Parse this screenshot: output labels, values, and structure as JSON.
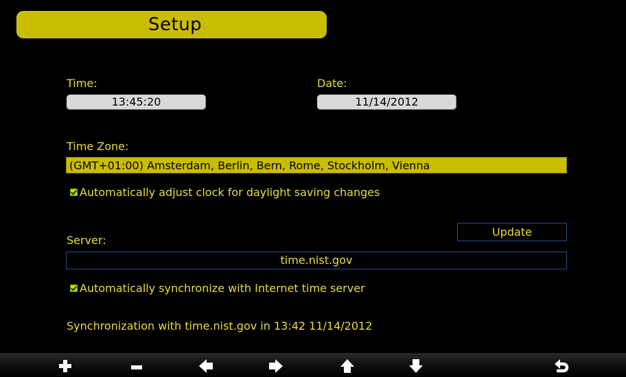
{
  "header": {
    "title": "Setup"
  },
  "time": {
    "label": "Time:",
    "value": "13:45:20"
  },
  "date": {
    "label": "Date:",
    "value": "11/14/2012"
  },
  "timezone": {
    "label": "Time Zone:",
    "value": "(GMT+01:00) Amsterdam, Berlin, Bern, Rome, Stockholm, Vienna"
  },
  "dst_checkbox": {
    "label": "Automatically adjust clock for daylight saving changes",
    "checked": true
  },
  "update_button": {
    "label": "Update"
  },
  "server": {
    "label": "Server:",
    "value": "time.nist.gov"
  },
  "sync_checkbox": {
    "label": "Automatically synchronize with Internet time server",
    "checked": true
  },
  "sync_status": "Synchronization with time.nist.gov in 13:42 11/14/2012",
  "toolbar": {
    "buttons": [
      {
        "icon": "plus-icon"
      },
      {
        "icon": "minus-icon"
      },
      {
        "icon": "arrow-left-icon"
      },
      {
        "icon": "arrow-right-icon"
      },
      {
        "icon": "arrow-up-icon"
      },
      {
        "icon": "arrow-down-icon"
      },
      {
        "icon": "return-icon"
      }
    ]
  },
  "colors": {
    "accent": "#c9bd00",
    "text": "#e8dc40",
    "checkbox": "#b6e51e",
    "field_border": "#2d4f8a",
    "background": "#000000"
  }
}
